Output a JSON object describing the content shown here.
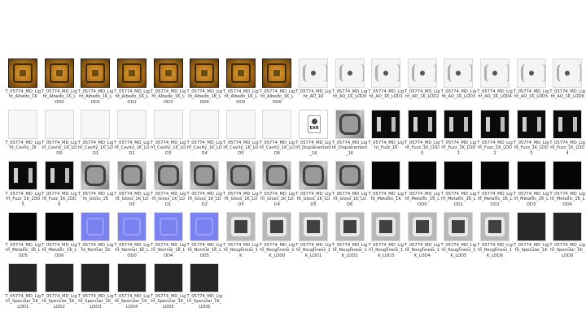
{
  "files": [
    {
      "name": "T_05774_MD_Light_Albedo_1K",
      "type": "albedo"
    },
    {
      "name": "T_05774_MD_Light_Albedo_1K_LOD0",
      "type": "albedo"
    },
    {
      "name": "T_05774_MD_Light_Albedo_1K_LOD1",
      "type": "albedo"
    },
    {
      "name": "T_05774_MD_Light_Albedo_1K_LOD2",
      "type": "albedo"
    },
    {
      "name": "T_05774_MD_Light_Albedo_1K_LOD3",
      "type": "albedo"
    },
    {
      "name": "T_05774_MD_Light_Albedo_1K_LOD4",
      "type": "albedo"
    },
    {
      "name": "T_05774_MD_Light_Albedo_1K_LOD5",
      "type": "albedo"
    },
    {
      "name": "T_05774_MD_Light_Albedo_1K_LOD6",
      "type": "albedo"
    },
    {
      "name": "T_05774_MD_Light_AO_1K",
      "type": "ao"
    },
    {
      "name": "T_05774_MD_Light_AO_1K_LOD0",
      "type": "ao"
    },
    {
      "name": "T_05774_MD_Light_AO_1K_LOD1",
      "type": "ao"
    },
    {
      "name": "T_05774_MD_Light_AO_1K_LOD2",
      "type": "ao"
    },
    {
      "name": "T_05774_MD_Light_AO_1K_LOD3",
      "type": "ao"
    },
    {
      "name": "T_05774_MD_Light_AO_1K_LOD4",
      "type": "ao"
    },
    {
      "name": "T_05774_MD_Light_AO_1K_LOD5",
      "type": "ao"
    },
    {
      "name": "T_05774_MD_Light_AO_1K_LOD6",
      "type": "ao"
    },
    {
      "name": "T_05774_MD_Light_Cavity_1K",
      "type": "cavity"
    },
    {
      "name": "T_05774_MD_Light_Cavity_1K_LOD0",
      "type": "cavity"
    },
    {
      "name": "T_05774_MD_Light_Cavity_1K_LOD1",
      "type": "cavity"
    },
    {
      "name": "T_05774_MD_Light_Cavity_1K_LOD2",
      "type": "cavity"
    },
    {
      "name": "T_05774_MD_Light_Cavity_1K_LOD3",
      "type": "cavity"
    },
    {
      "name": "T_05774_MD_Light_Cavity_1K_LOD4",
      "type": "cavity"
    },
    {
      "name": "T_05774_MD_Light_Cavity_1K_LOD5",
      "type": "cavity"
    },
    {
      "name": "T_05774_MD_Light_Cavity_1K_LOD6",
      "type": "cavity"
    },
    {
      "name": "T_05774_MD_Light_Displacement_1K",
      "type": "exr",
      "badge": "EXR"
    },
    {
      "name": "T_05774_MD_Light_Displacement_1K",
      "type": "disp"
    },
    {
      "name": "T_05774_MD_Light_Fuzz_1K",
      "type": "fuzz"
    },
    {
      "name": "T_05774_MD_Light_Fuzz_1K_LOD0",
      "type": "fuzz"
    },
    {
      "name": "T_05774_MD_Light_Fuzz_1K_LOD1",
      "type": "fuzz"
    },
    {
      "name": "T_05774_MD_Light_Fuzz_1K_LOD2",
      "type": "fuzz"
    },
    {
      "name": "T_05774_MD_Light_Fuzz_1K_LOD3",
      "type": "fuzz"
    },
    {
      "name": "T_05774_MD_Light_Fuzz_1K_LOD4",
      "type": "fuzz"
    },
    {
      "name": "T_05774_MD_Light_Fuzz_1K_LOD5",
      "type": "fuzz"
    },
    {
      "name": "T_05774_MD_Light_Fuzz_1K_LOD6",
      "type": "fuzz"
    },
    {
      "name": "T_05774_MD_Light_Gloss_1K",
      "type": "disp"
    },
    {
      "name": "T_05774_MD_Light_Gloss_1K_LOD0",
      "type": "disp"
    },
    {
      "name": "T_05774_MD_Light_Gloss_1K_LOD1",
      "type": "disp"
    },
    {
      "name": "T_05774_MD_Light_Gloss_1K_LOD2",
      "type": "disp"
    },
    {
      "name": "T_05774_MD_Light_Gloss_1K_LOD3",
      "type": "disp"
    },
    {
      "name": "T_05774_MD_Light_Gloss_1K_LOD4",
      "type": "disp"
    },
    {
      "name": "T_05774_MD_Light_Gloss_1K_LOD5",
      "type": "disp"
    },
    {
      "name": "T_05774_MD_Light_Gloss_1K_LOD6",
      "type": "disp"
    },
    {
      "name": "T_05774_MD_Light_Metallic_1K",
      "type": "metal"
    },
    {
      "name": "T_05774_MD_Light_Metallic_1K_LOD0",
      "type": "metal"
    },
    {
      "name": "T_05774_MD_Light_Metallic_1K_LOD1",
      "type": "metal"
    },
    {
      "name": "T_05774_MD_Light_Metallic_1K_LOD2",
      "type": "metal"
    },
    {
      "name": "T_05774_MD_Light_Metallic_1K_LOD3",
      "type": "metal"
    },
    {
      "name": "T_05774_MD_Light_Metallic_1K_LOD4",
      "type": "metal"
    },
    {
      "name": "T_05774_MD_Light_Metallic_1K_LOD5",
      "type": "metal"
    },
    {
      "name": "T_05774_MD_Light_Metallic_1K_LOD6",
      "type": "metal"
    },
    {
      "name": "T_05774_MD_Light_Normal_1K",
      "type": "normal"
    },
    {
      "name": "T_05774_MD_Light_Normal_1K_LOD0",
      "type": "normal"
    },
    {
      "name": "T_05774_MD_Light_Normal_1K_LOD4",
      "type": "normal"
    },
    {
      "name": "T_05774_MD_Light_Normal_1K_LOD5",
      "type": "normal"
    },
    {
      "name": "T_05774_MD_Light_Roughness_1K",
      "type": "rough"
    },
    {
      "name": "T_05774_MD_Light_Roughness_1K_LOD0",
      "type": "rough"
    },
    {
      "name": "T_05774_MD_Light_Roughness_1K_LOD1",
      "type": "rough"
    },
    {
      "name": "T_05774_MD_Light_Roughness_1K_LOD2",
      "type": "rough"
    },
    {
      "name": "T_05774_MD_Light_Roughness_1K_LOD3",
      "type": "rough"
    },
    {
      "name": "T_05774_MD_Light_Roughness_1K_LOD4",
      "type": "rough"
    },
    {
      "name": "T_05774_MD_Light_Roughness_1K_LOD5",
      "type": "rough"
    },
    {
      "name": "T_05774_MD_Light_Roughness_1K_LOD6",
      "type": "rough"
    },
    {
      "name": "T_05774_MD_Light_Specular_1K",
      "type": "spec"
    },
    {
      "name": "T_05774_MD_Light_Specular_1K_LOD0",
      "type": "spec"
    },
    {
      "name": "T_05774_MD_Light_Specular_1K_LOD1",
      "type": "spec"
    },
    {
      "name": "T_05774_MD_Light_Specular_1K_LOD2",
      "type": "spec"
    },
    {
      "name": "T_05774_MD_Light_Specular_1K_LOD3",
      "type": "spec"
    },
    {
      "name": "T_05774_MD_Light_Specular_1K_LOD4",
      "type": "spec"
    },
    {
      "name": "T_05774_MD_Light_Specular_1K_LOD5",
      "type": "spec"
    },
    {
      "name": "T_05774_MD_Light_Specular_1K_LOD6",
      "type": "spec"
    }
  ]
}
